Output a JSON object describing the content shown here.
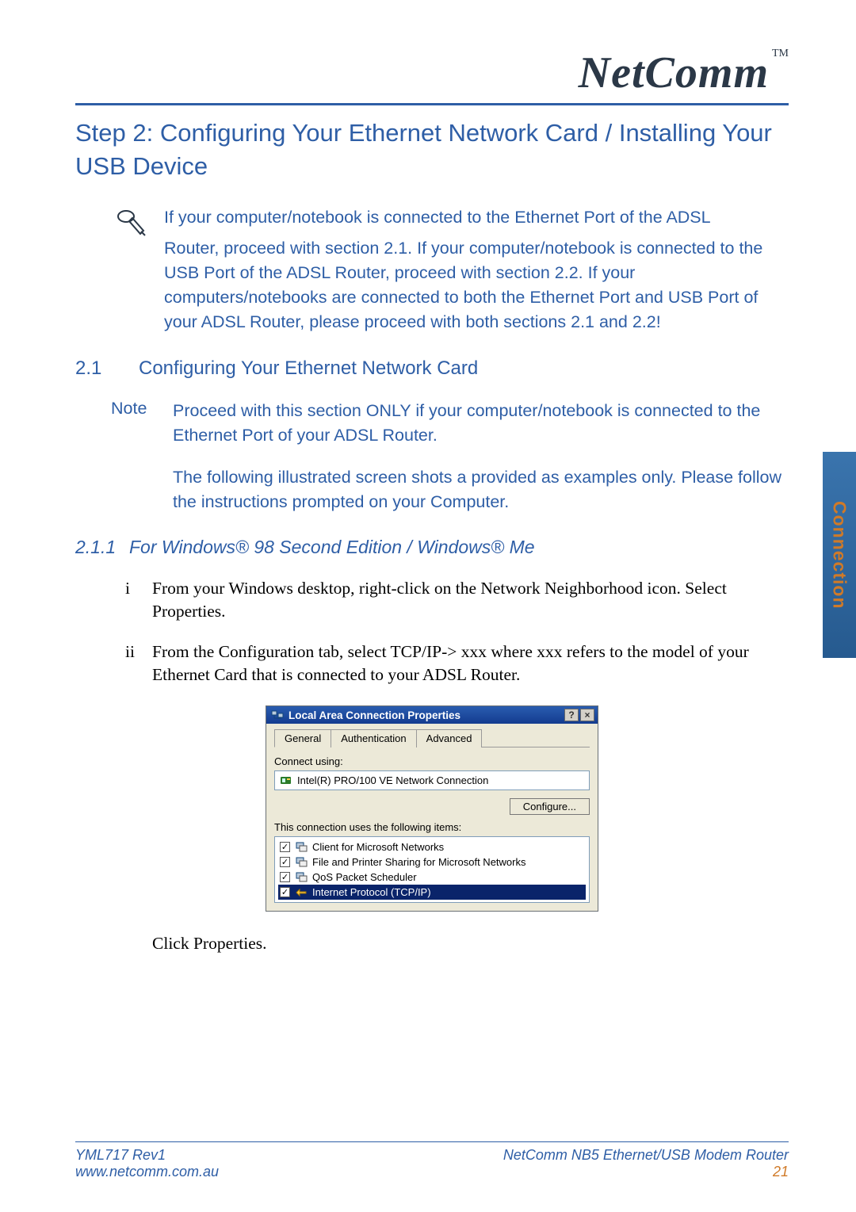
{
  "brand": {
    "name": "NetComm",
    "tm": "TM"
  },
  "headings": {
    "step_title": "Step 2:  Configuring Your Ethernet Network Card / Installing Your USB Device",
    "section_num": "2.1",
    "section_title": "Configuring Your Ethernet Network Card",
    "subsection_num": "2.1.1",
    "subsection_title": "For Windows® 98 Second Edition / Windows® Me"
  },
  "intro": {
    "line1": "If your computer/notebook is connected to the Ethernet Port of the ADSL",
    "rest": "Router, proceed with section 2.1.  If your computer/notebook is connected to the USB Port of the ADSL Router, proceed with section 2.2.  If your computers/notebooks are connected to both the Ethernet Port and USB Port of your ADSL Router, please proceed with both sections 2.1 and 2.2!"
  },
  "note": {
    "label": "Note",
    "para1": "Proceed with this section ONLY if your computer/notebook is connected to the Ethernet Port of your ADSL Router.",
    "para2": "The following illustrated screen shots a provided as examples only.  Please follow the instructions prompted on your Computer."
  },
  "steps": {
    "i_marker": "i",
    "i_text": "From your Windows desktop, right-click on the Network Neighborhood icon.  Select Properties.",
    "ii_marker": "ii",
    "ii_text": "From the Configuration tab, select TCP/IP-> xxx where xxx refers to the model of your Ethernet Card that is connected to your ADSL Router.",
    "post": "Click Properties."
  },
  "dialog": {
    "title": "Local Area Connection Properties",
    "help_btn": "?",
    "close_btn": "×",
    "tabs": {
      "general": "General",
      "auth": "Authentication",
      "advanced": "Advanced"
    },
    "connect_label": "Connect using:",
    "adapter": "Intel(R) PRO/100 VE Network Connection",
    "configure_btn": "Configure...",
    "items_label": "This connection uses the following items:",
    "items": [
      "Client for Microsoft Networks",
      "File and Printer Sharing for Microsoft Networks",
      "QoS Packet Scheduler",
      "Internet Protocol (TCP/IP)"
    ]
  },
  "side_tab": "Connection",
  "footer": {
    "doc_id": "YML717 Rev1",
    "product": "NetComm NB5 Ethernet/USB Modem Router",
    "url": "www.netcomm.com.au",
    "page": "21"
  }
}
